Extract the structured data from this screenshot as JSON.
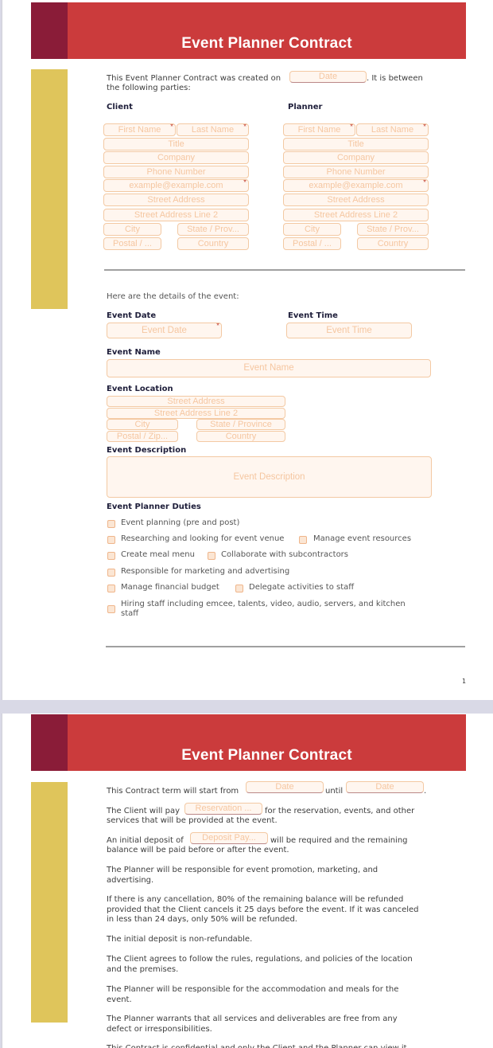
{
  "document": {
    "title": "Event Planner Contract",
    "page_number": "1",
    "colors": {
      "header_red": "#cb3b3c",
      "header_accent": "#8a1c38",
      "side_bar_gold": "#dfc55b",
      "field_border": "#f3c9a3",
      "field_placeholder": "#f5c6a0",
      "required_asterisk": "#c0392b"
    }
  },
  "page1": {
    "intro_before": "This Event Planner Contract was created on",
    "intro_date_placeholder": "Date",
    "intro_after_line1": ". It  is between",
    "intro_line2": "the following parties:",
    "client": {
      "heading": "Client",
      "first_name": "First Name",
      "last_name": "Last Name",
      "title": "Title",
      "company": "Company",
      "phone": "Phone Number",
      "email": "example@example.com",
      "street": "Street Address",
      "street2": "Street Address Line 2",
      "city": "City",
      "state": "State / Prov...",
      "postal": "Postal / ...",
      "country": "Country"
    },
    "planner": {
      "heading": "Planner",
      "first_name": "First Name",
      "last_name": "Last Name",
      "title": "Title",
      "company": "Company",
      "phone": "Phone Number",
      "email": "example@example.com",
      "street": "Street Address",
      "street2": "Street Address Line 2",
      "city": "City",
      "state": "State / Prov...",
      "postal": "Postal / ...",
      "country": "Country"
    },
    "required_marker": "*",
    "details_intro": "Here are the details of the event:",
    "event_date_label": "Event Date",
    "event_date_placeholder": "Event Date",
    "event_time_label": "Event Time",
    "event_time_placeholder": "Event Time",
    "event_name_label": "Event Name",
    "event_name_placeholder": "Event Name",
    "event_location_label": "Event Location",
    "location": {
      "street": "Street Address",
      "street2": "Street Address Line 2",
      "city": "City",
      "state": "State / Province",
      "postal": "Postal / Zip...",
      "country": "Country"
    },
    "event_description_label": "Event Description",
    "event_description_placeholder": "Event Description",
    "duties_label": "Event Planner Duties",
    "duties": [
      "Event planning (pre and post)",
      "Researching and looking for event venue",
      "Manage event resources",
      "Create meal menu",
      "Collaborate with subcontractors",
      "Responsible for marketing and advertising",
      "Manage financial budget",
      "Delegate activities to staff",
      "Hiring staff including emcee, talents, video, audio, servers, and kitchen",
      "staff"
    ]
  },
  "page2": {
    "term_before": "This Contract term will start from",
    "term_start_placeholder": "Date",
    "term_middle": "until",
    "term_end_placeholder": "Date",
    "term_after": ".",
    "pay_before": "The Client will pay",
    "pay_placeholder": "Reservation ...",
    "pay_after_line1": "for the reservation, events, and other",
    "pay_line2": "services that will be provided at the event.",
    "deposit_before": "An initial deposit of",
    "deposit_placeholder": "Deposit Pay...",
    "deposit_after_line1": "will be required and the remaining",
    "deposit_line2": "balance will be paid before or after the event.",
    "paragraphs": [
      [
        "The Planner will be responsible for event promotion, marketing, and",
        "advertising."
      ],
      [
        "If there is any cancellation, 80% of the remaining balance will be refunded",
        "provided that the Client cancels it 25 days before the event. If it was canceled",
        "in less than 24 days, only 50% will be refunded."
      ],
      [
        "The initial deposit is non-refundable."
      ],
      [
        "The Client agrees to follow the rules, regulations, and policies of the location",
        "and the premises."
      ],
      [
        "The Planner will be responsible for the accommodation and meals for the",
        "event."
      ],
      [
        "The Planner warrants that all services and deliverables are free from any",
        "defect or irresponsibilities."
      ],
      [
        "This Contract is confidential and only the Client and the Planner can view it"
      ]
    ]
  }
}
